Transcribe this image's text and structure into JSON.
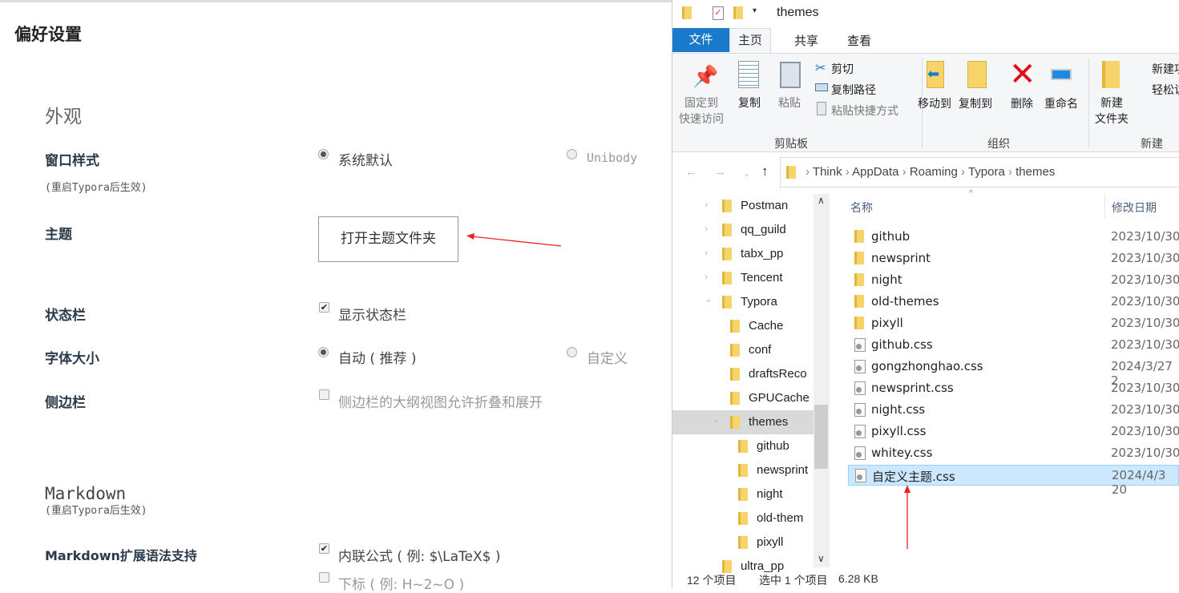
{
  "prefs": {
    "title": "偏好设置",
    "appearance": "外观",
    "window_style": "窗口样式",
    "restart_note": "(重启Typora后生效)",
    "system_default": "系统默认",
    "unibody": "Unibody",
    "theme": "主题",
    "open_theme_folder": "打开主题文件夹",
    "status_bar": "状态栏",
    "show_status_bar": "显示状态栏",
    "font_size": "字体大小",
    "auto": "自动 ( 推荐 )",
    "custom": "自定义",
    "sidebar": "侧边栏",
    "sidebar_opt": "侧边栏的大纲视图允许折叠和展开",
    "markdown": "Markdown",
    "md_restart": "(重启Typora后生效)",
    "md_ext": "Markdown扩展语法支持",
    "inline_math": "内联公式 ( 例: $\\LaTeX$ )",
    "subscript": "下标 ( 例: H~2~O )"
  },
  "explorer": {
    "title": "themes",
    "tabs": [
      "文件",
      "主页",
      "共享",
      "查看"
    ],
    "ribbon": {
      "pin": "固定到\n快速访问",
      "copy": "复制",
      "paste": "粘贴",
      "cut": "剪切",
      "copy_path": "复制路径",
      "paste_shortcut": "粘贴快捷方式",
      "clipboard": "剪贴板",
      "move_to": "移动到",
      "copy_to": "复制到",
      "delete": "删除",
      "rename": "重命名",
      "organize": "组织",
      "new_folder": "新建\n文件夹",
      "new_item": "新建项",
      "easy_access": "轻松访",
      "new": "新建"
    },
    "breadcrumb": [
      "Think",
      "AppData",
      "Roaming",
      "Typora",
      "themes"
    ],
    "tree": [
      "Postman",
      "qq_guild",
      "tabx_pp",
      "Tencent",
      "Typora",
      "Cache",
      "conf",
      "draftsReco",
      "GPUCache",
      "themes",
      "github",
      "newsprint",
      "night",
      "old-them",
      "pixyll",
      "ultra_pp"
    ],
    "columns": {
      "name": "名称",
      "date": "修改日期"
    },
    "files": [
      {
        "name": "github",
        "date": "2023/10/30",
        "type": "folder"
      },
      {
        "name": "newsprint",
        "date": "2023/10/30",
        "type": "folder"
      },
      {
        "name": "night",
        "date": "2023/10/30",
        "type": "folder"
      },
      {
        "name": "old-themes",
        "date": "2023/10/30",
        "type": "folder"
      },
      {
        "name": "pixyll",
        "date": "2023/10/30",
        "type": "folder"
      },
      {
        "name": "github.css",
        "date": "2023/10/30",
        "type": "file"
      },
      {
        "name": "gongzhonghao.css",
        "date": "2024/3/27 2",
        "type": "file"
      },
      {
        "name": "newsprint.css",
        "date": "2023/10/30",
        "type": "file"
      },
      {
        "name": "night.css",
        "date": "2023/10/30",
        "type": "file"
      },
      {
        "name": "pixyll.css",
        "date": "2023/10/30",
        "type": "file"
      },
      {
        "name": "whitey.css",
        "date": "2023/10/30",
        "type": "file"
      },
      {
        "name": "自定义主题.css",
        "date": "2024/4/3 20",
        "type": "file",
        "selected": true
      }
    ],
    "status": {
      "count": "12 个项目",
      "selected": "选中 1 个项目",
      "size": "6.28 KB"
    },
    "accent": "#1979ca"
  }
}
